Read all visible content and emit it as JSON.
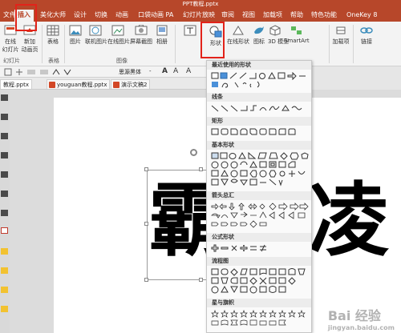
{
  "window": {
    "title": "PPT教程.pptx"
  },
  "tabs": [
    {
      "label": "文件"
    },
    {
      "label": "插入"
    },
    {
      "label": "美化大师"
    },
    {
      "label": "设计"
    },
    {
      "label": "切换"
    },
    {
      "label": "动画"
    },
    {
      "label": "口袋动画 PA"
    },
    {
      "label": "幻灯片放映"
    },
    {
      "label": "审阅"
    },
    {
      "label": "视图"
    },
    {
      "label": "加载项"
    },
    {
      "label": "帮助"
    },
    {
      "label": "特色功能"
    },
    {
      "label": "OneKey 8"
    }
  ],
  "ribbon": {
    "new_slide": {
      "line1": "在线",
      "line2": "幻灯片"
    },
    "new_slide2": {
      "line1": "新加",
      "line2": "动画页"
    },
    "table": {
      "label": "表格"
    },
    "image": {
      "label": "图片"
    },
    "online_image": {
      "label": "联机图片"
    },
    "web_image": {
      "label": "在线图片"
    },
    "screenshot": {
      "label": "屏幕截图"
    },
    "album": {
      "label": "相册"
    },
    "shapes": {
      "label": "形状"
    },
    "online_shapes": {
      "label": "在线形状"
    },
    "icons": {
      "label": "图标"
    },
    "model3d": {
      "label": "3D 模型"
    },
    "smartart": {
      "label": "SmartArt"
    },
    "addins": {
      "label": "加载项"
    },
    "link": {
      "label": "链接"
    },
    "group_slides": "幻灯片",
    "group_tables": "表格",
    "group_images": "图像"
  },
  "format_bar": {
    "font": "思源黑体",
    "size": "-"
  },
  "doc_tabs": [
    {
      "label": "教程.pptx"
    },
    {
      "label": "youguan教程.pptx"
    },
    {
      "label": "演示文稿2"
    }
  ],
  "slide": {
    "char_left": "霸",
    "char_right": "凌"
  },
  "gallery": {
    "sections": [
      {
        "label": "最近使用的形状"
      },
      {
        "label": "线条"
      },
      {
        "label": "矩形"
      },
      {
        "label": "基本形状"
      },
      {
        "label": "箭头总汇"
      },
      {
        "label": "公式形状"
      },
      {
        "label": "流程图"
      },
      {
        "label": "星与旗帜"
      }
    ]
  },
  "watermark": {
    "text": "Bai 经验",
    "sub": "jingyan.baidu.com"
  },
  "colors": {
    "accent": "#b7472a",
    "highlight": "#e2231a"
  }
}
